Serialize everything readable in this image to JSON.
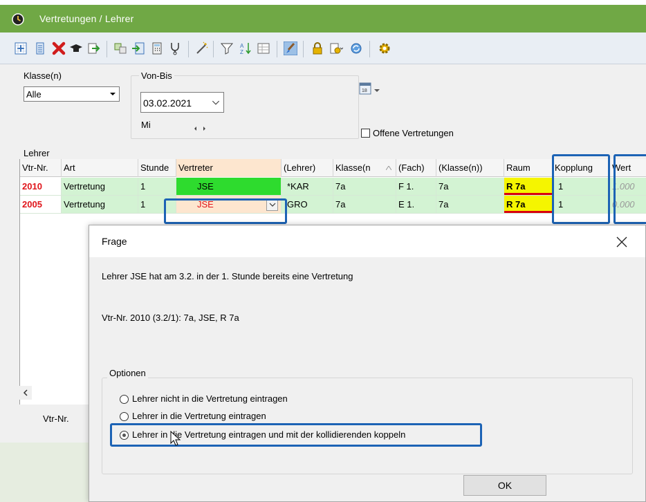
{
  "window": {
    "title": "Vertretungen / Lehrer",
    "titlebar_color": "#70a845"
  },
  "toolbar": {
    "icons": [
      "expand-icon",
      "list-icon",
      "delete-icon",
      "teacher-icon",
      "export-icon",
      "swap-icon",
      "import-icon",
      "calculator-icon",
      "stethoscope-icon",
      "magic-wand-icon",
      "filter-icon",
      "sort-icon",
      "grid-icon",
      "brush-icon",
      "lock-icon",
      "settings-dropdown-icon",
      "refresh-icon",
      "gear-icon"
    ]
  },
  "filter": {
    "klasse_label": "Klasse(n)",
    "klasse_value": "Alle",
    "vonbis_label": "Von-Bis",
    "date_value": "03.02.2021",
    "weekday": "Mi",
    "open_label": "Offene Vertretungen",
    "lehrer_label": "Lehrer"
  },
  "grid": {
    "headers": {
      "nr": "Vtr-Nr.",
      "art": "Art",
      "stunde": "Stunde",
      "vertreter": "Vertreter",
      "lehrer": "(Lehrer)",
      "klasse": "Klasse(n",
      "fach": "(Fach)",
      "klasse2": "(Klasse(n))",
      "raum": "Raum",
      "kopplung": "Kopplung",
      "wert": "Wert"
    },
    "rows": [
      {
        "nr": "2010",
        "art": "Vertretung",
        "stunde": "1",
        "vertreter": "JSE",
        "lehrer": "*KAR",
        "klasse": "7a",
        "fach": "F 1.",
        "klasse2": "7a",
        "raum": "R 7a",
        "kopplung": "1",
        "wert": "1.000"
      },
      {
        "nr": "2005",
        "art": "Vertretung",
        "stunde": "1",
        "vertreter": "JSE",
        "lehrer": "GRO",
        "klasse": "7a",
        "fach": "E 1.",
        "klasse2": "7a",
        "raum": "R 7a",
        "kopplung": "1",
        "wert": "0.000"
      }
    ]
  },
  "status": {
    "label": "Vtr-Nr."
  },
  "dialog": {
    "title": "Frage",
    "message1": "Lehrer JSE hat am 3.2. in der 1. Stunde bereits eine Vertretung",
    "message2": "Vtr-Nr. 2010 (3.2/1): 7a, JSE, R 7a",
    "options_legend": "Optionen",
    "option1": "Lehrer nicht in die Vertretung eintragen",
    "option2": "Lehrer in die Vertretung eintragen",
    "option3": "Lehrer in die Vertretung eintragen und mit der kollidierenden koppeln",
    "ok_label": "OK"
  },
  "colors": {
    "highlight": "#1c63b5",
    "vtr_nr": "#e0141a",
    "room": "#f5f500",
    "vertreter_ok": "#2edb2e"
  }
}
